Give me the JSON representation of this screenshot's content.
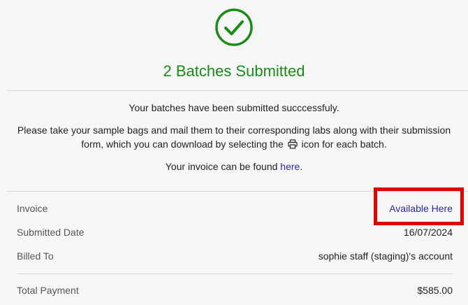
{
  "header": {
    "title": "2 Batches Submitted"
  },
  "messages": {
    "line1": "Your batches have been submitted succcessfuly.",
    "line2_before": "Please take your sample bags and mail them to their corresponding labs along with their submission form, which you can download by selecting the",
    "line2_after": "icon for each batch.",
    "line3_before": "Your invoice can be found",
    "line3_link": "here",
    "line3_after": "."
  },
  "summary": {
    "invoice_label": "Invoice",
    "invoice_value": "Available Here",
    "date_label": "Submitted Date",
    "date_value": "16/07/2024",
    "billed_label": "Billed To",
    "billed_value": "sophie staff (staging)'s account",
    "total_label": "Total Payment",
    "total_value": "$585.00"
  },
  "colors": {
    "success": "#1a8a1a",
    "link": "#2a2aa0",
    "highlight": "#e00000"
  },
  "icons": [
    "check-circle-icon",
    "printer-icon"
  ]
}
